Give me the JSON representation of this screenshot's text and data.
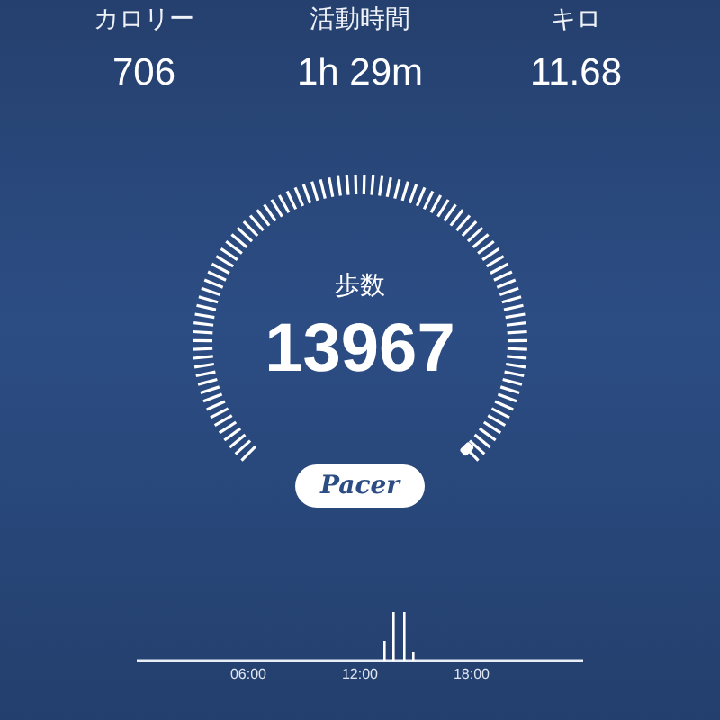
{
  "stats": [
    {
      "label": "カロリー",
      "value": "706"
    },
    {
      "label": "活動時間",
      "value": "1h 29m"
    },
    {
      "label": "キロ",
      "value": "11.68"
    }
  ],
  "steps": {
    "label": "歩数",
    "value": "13967"
  },
  "brand": "Pacer",
  "timeline": {
    "labels": [
      "06:00",
      "12:00",
      "18:00"
    ]
  }
}
